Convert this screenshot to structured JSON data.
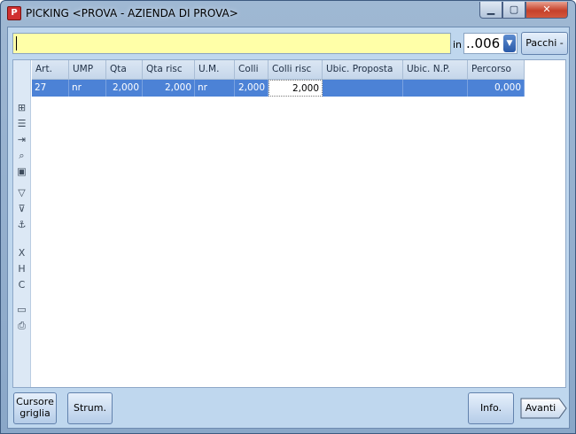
{
  "window": {
    "title": "PICKING <PROVA - AZIENDA DI PROVA>",
    "min_glyph": "▁",
    "max_glyph": "▢",
    "close_glyph": "✕",
    "app_glyph": "P"
  },
  "topbar": {
    "barcode_value": "",
    "in_label": "in",
    "combo_value": "..006",
    "pacchi_label": "Pacchi ->"
  },
  "grid": {
    "columns": [
      "Art.",
      "UMP",
      "Qta",
      "Qta risc",
      "U.M.",
      "Colli",
      "Colli risc",
      "Ubic. Proposta",
      "Ubic. N.P.",
      "Percorso"
    ],
    "rows": [
      [
        "27",
        "nr",
        "2,000",
        "2,000",
        "nr",
        "2,000",
        "2,000",
        "",
        "",
        "0,000"
      ]
    ]
  },
  "tools": {
    "icons": [
      "grid-select-icon",
      "list-icon",
      "insert-row-icon",
      "search-icon",
      "fit-columns-icon",
      "filter-icon",
      "filter-clear-icon",
      "anchor-icon",
      "delete-column-icon",
      "hide-column-icon",
      "column-config-icon",
      "monitor-icon",
      "print-icon"
    ]
  },
  "buttons": {
    "cursore_line1": "Cursore",
    "cursore_line2": "griglia",
    "strum": "Strum.",
    "info": "Info.",
    "avanti": "Avanti"
  }
}
